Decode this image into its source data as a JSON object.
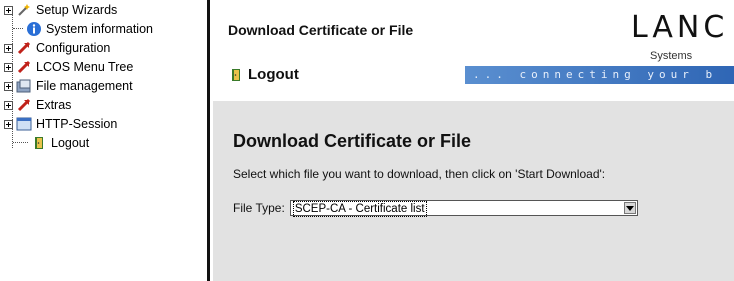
{
  "nav": {
    "items": [
      {
        "label": "Setup Wizards",
        "icon": "wand-icon",
        "expandable": true
      },
      {
        "label": "System information",
        "icon": "info-icon",
        "expandable": false
      },
      {
        "label": "Configuration",
        "icon": "red-arrow-icon",
        "expandable": true
      },
      {
        "label": "LCOS Menu Tree",
        "icon": "red-arrow-icon",
        "expandable": true
      },
      {
        "label": "File management",
        "icon": "folder-icon",
        "expandable": true
      },
      {
        "label": "Extras",
        "icon": "red-arrow-icon",
        "expandable": true
      },
      {
        "label": "HTTP-Session",
        "icon": "window-icon",
        "expandable": true
      },
      {
        "label": "Logout",
        "icon": "door-icon",
        "expandable": false
      }
    ]
  },
  "header": {
    "title": "Download Certificate or File",
    "logo_text": "LANC",
    "logo_sub": "Systems",
    "logout_label": "Logout",
    "tagline": "... connecting your b"
  },
  "main": {
    "heading": "Download Certificate or File",
    "instruction": "Select which file you want to download, then click on 'Start Download':",
    "file_type_label": "File Type:",
    "file_type_value": "SCEP-CA - Certificate list"
  },
  "colors": {
    "tagline_bar": "#2f66b5",
    "content_bg": "#e2e2e2",
    "divider": "#111111"
  }
}
